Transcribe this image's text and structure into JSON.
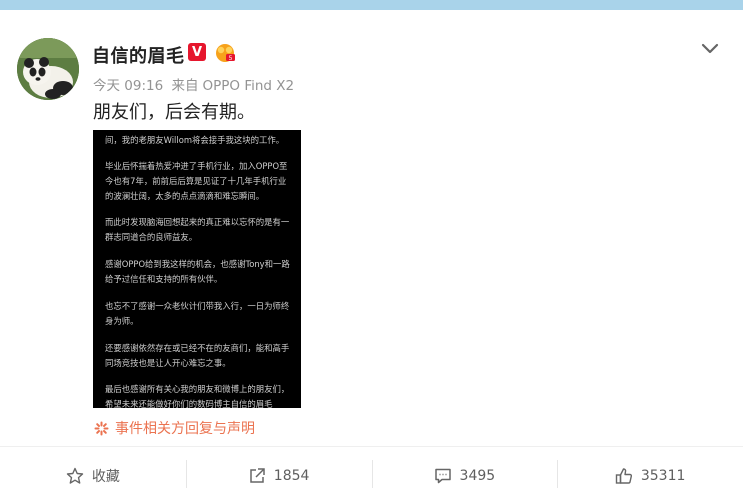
{
  "post": {
    "username": "自信的眉毛",
    "verified_badge": "V",
    "timestamp": "今天 09:16",
    "source_prefix": "来自",
    "source": "OPPO Find X2",
    "text": "朋友们，后会有期。",
    "image_lines": [
      "间，我的老朋友Willom将会接手我这块的工作。",
      "毕业后怀揣着热爱冲进了手机行业，加入OPPO至",
      "今也有7年，前前后后算是见证了十几年手机行业",
      "的波澜壮阔，太多的点点滴滴和难忘瞬间。",
      "而此时发现脑海回想起来的真正难以忘怀的是有一",
      "群志同道合的良师益友。",
      "感谢OPPO给到我这样的机会，也感谢Tony和一路",
      "给予过信任和支持的所有伙伴。",
      "也忘不了感谢一众老伙计们带我入行，一日为师终",
      "身为师。",
      "还要感谢依然存在或已经不在的友商们，能和高手",
      "同场竞技也是让人开心难忘之事。",
      "最后也感谢所有关心我的朋友和微博上的朋友们，",
      "希望未来还能做好你们的数码博主自信的眉毛"
    ],
    "event_link": "事件相关方回复与声明"
  },
  "actions": {
    "favorite": "收藏",
    "repost": "1854",
    "comment": "3495",
    "like": "35311"
  },
  "colors": {
    "top_strip": "#a9d3ea",
    "event_link": "#eb7350",
    "verified": "#e6162d",
    "meta": "#939393"
  },
  "icons": {
    "more": "chevron-down-icon",
    "favorite": "star-icon",
    "repost": "share-icon",
    "comment": "comment-icon",
    "like": "thumbs-up-icon",
    "event": "sparkle-icon"
  }
}
